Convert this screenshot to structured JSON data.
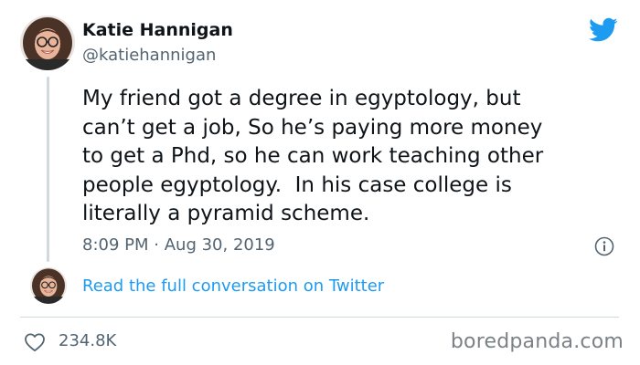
{
  "author": {
    "display_name": "Katie Hannigan",
    "handle": "@katiehannigan"
  },
  "tweet": {
    "lines": [
      "My friend got a degree in egyptology, but",
      "can’t get a job, So he’s paying more money",
      "to get a Phd, so he can work teaching other",
      "people egyptology.  In his case college is",
      "literally a pyramid scheme."
    ],
    "time": "8:09 PM",
    "separator": "·",
    "date": "Aug 30, 2019"
  },
  "read_link": "Read the full conversation on Twitter",
  "likes": {
    "count": "234.8K"
  },
  "watermark": "boredpanda.com",
  "icons": {
    "brand": "twitter-bird-icon",
    "info": "info-icon",
    "like": "heart-icon"
  },
  "colors": {
    "twitter_blue": "#1d9bf0",
    "secondary_text": "#536471",
    "primary_text": "#0f1419",
    "divider": "#cfd9de"
  }
}
